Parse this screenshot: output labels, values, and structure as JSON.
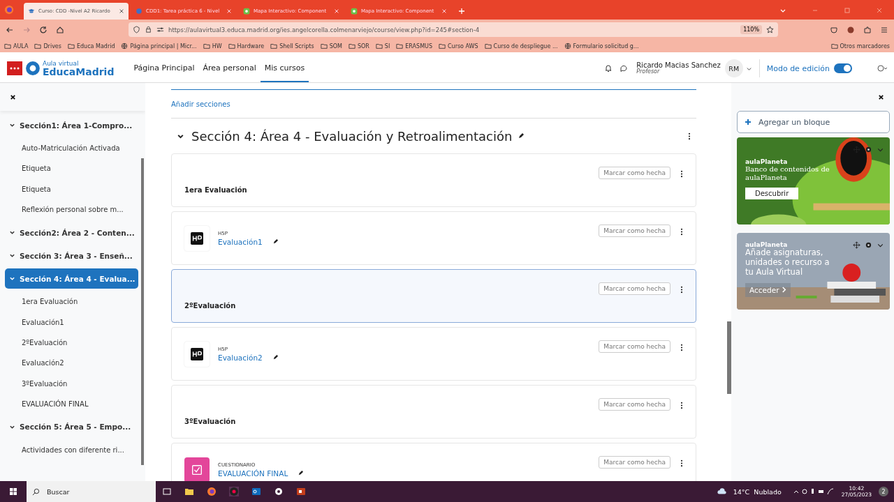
{
  "browser": {
    "tabs": [
      {
        "title": "Curso: CDD -Nivel A2 Ricardo",
        "selected": true,
        "kind": "course"
      },
      {
        "title": "CDD1: Tarea práctica 6 - Nivel",
        "selected": false,
        "kind": "task"
      },
      {
        "title": "Mapa Interactivo: Component",
        "selected": false,
        "kind": "h5p"
      },
      {
        "title": "Mapa Interactivo: Component",
        "selected": false,
        "kind": "h5p"
      }
    ],
    "url": "https://aulavirtual3.educa.madrid.org/ies.angelcorella.colmenarviejo/course/view.php?id=245#section-4",
    "zoom": "110%",
    "bookmarks": [
      {
        "label": "AULA",
        "kind": "folder"
      },
      {
        "label": "Drives",
        "kind": "folder"
      },
      {
        "label": "Educa Madrid",
        "kind": "folder"
      },
      {
        "label": "Página principal | Micr...",
        "kind": "globe"
      },
      {
        "label": "HW",
        "kind": "folder"
      },
      {
        "label": "Hardware",
        "kind": "folder"
      },
      {
        "label": "Shell Scripts",
        "kind": "folder"
      },
      {
        "label": "SOM",
        "kind": "folder"
      },
      {
        "label": "SOR",
        "kind": "folder"
      },
      {
        "label": "SI",
        "kind": "folder"
      },
      {
        "label": "ERASMUS",
        "kind": "folder"
      },
      {
        "label": "Curso AWS",
        "kind": "folder"
      },
      {
        "label": "Curso de despliegue ...",
        "kind": "folder"
      },
      {
        "label": "Formulario solicitud g...",
        "kind": "globe"
      }
    ],
    "other_bookmarks": "Otros marcadores"
  },
  "header": {
    "logo_small": "Aula virtual",
    "logo_big": "EducaMadrid",
    "nav": [
      {
        "label": "Página Principal",
        "selected": false
      },
      {
        "label": "Área personal",
        "selected": false
      },
      {
        "label": "Mis cursos",
        "selected": true
      }
    ],
    "user_name": "Ricardo Macias Sanchez",
    "user_role": "Profesor",
    "initials": "RM",
    "edit_mode_label": "Modo de edición",
    "edit_mode": true
  },
  "course_index": [
    {
      "label": "Sección1: Área 1-Compro...",
      "kind": "section",
      "selected": false
    },
    {
      "label": "Auto-Matriculación Activada",
      "kind": "activity",
      "selected": false
    },
    {
      "label": "Etiqueta",
      "kind": "activity",
      "selected": false
    },
    {
      "label": "Etiqueta",
      "kind": "activity",
      "selected": false
    },
    {
      "label": "Reflexión personal sobre m...",
      "kind": "activity",
      "selected": false
    },
    {
      "label": "Sección2: Área 2 - Conten...",
      "kind": "section",
      "selected": false
    },
    {
      "label": "Sección 3: Área 3 - Enseñ...",
      "kind": "section",
      "selected": false
    },
    {
      "label": "Sección 4: Área 4 - Evalua...",
      "kind": "section",
      "selected": true
    },
    {
      "label": "1era Evaluación",
      "kind": "activity",
      "selected": false
    },
    {
      "label": "Evaluación1",
      "kind": "activity",
      "selected": false
    },
    {
      "label": "2ºEvaluación",
      "kind": "activity",
      "selected": false
    },
    {
      "label": "Evaluación2",
      "kind": "activity",
      "selected": false
    },
    {
      "label": "3ºEvaluación",
      "kind": "activity",
      "selected": false
    },
    {
      "label": "EVALUACIÓN FINAL",
      "kind": "activity",
      "selected": false
    },
    {
      "label": "Sección 5: Área 5 - Empo...",
      "kind": "section",
      "selected": false
    },
    {
      "label": "Actividades con diferente ri...",
      "kind": "activity",
      "selected": false
    }
  ],
  "content": {
    "add_sections": "Añadir secciones",
    "section_title": "Sección 4: Área 4 - Evaluación y Retroalimentación",
    "activities": [
      {
        "kind": "label",
        "name": "1era Evaluación",
        "button": "Marcar como hecha",
        "highlighted": false
      },
      {
        "kind": "h5p",
        "type": "H5P",
        "name": "Evaluación1",
        "button": "Marcar como hecha",
        "highlighted": false
      },
      {
        "kind": "label",
        "name": "2ºEvaluación",
        "button": "Marcar como hecha",
        "highlighted": true
      },
      {
        "kind": "h5p",
        "type": "H5P",
        "name": "Evaluación2",
        "button": "Marcar como hecha",
        "highlighted": false
      },
      {
        "kind": "label",
        "name": "3ºEvaluación",
        "button": "Marcar como hecha",
        "highlighted": false
      },
      {
        "kind": "quiz",
        "type": "CUESTIONARIO",
        "name": "EVALUACIÓN FINAL",
        "button": "Marcar como hecha",
        "highlighted": false
      }
    ]
  },
  "blocks": {
    "add_block": "Agregar un bloque",
    "promos": [
      {
        "kind": "frog",
        "brand": "aulaPlaneta",
        "text": "Banco de contenidos de aulaPlaneta",
        "button": "Descubrir"
      },
      {
        "kind": "books",
        "brand": "aulaPlaneta",
        "text": "Añade asignaturas, unidades o recurso a tu Aula Virtual",
        "button": "Acceder"
      }
    ]
  },
  "taskbar": {
    "search": "Buscar",
    "weather": "14°C  Nublado",
    "time": "10:42",
    "date": "27/05/2023",
    "notifications": "2"
  }
}
